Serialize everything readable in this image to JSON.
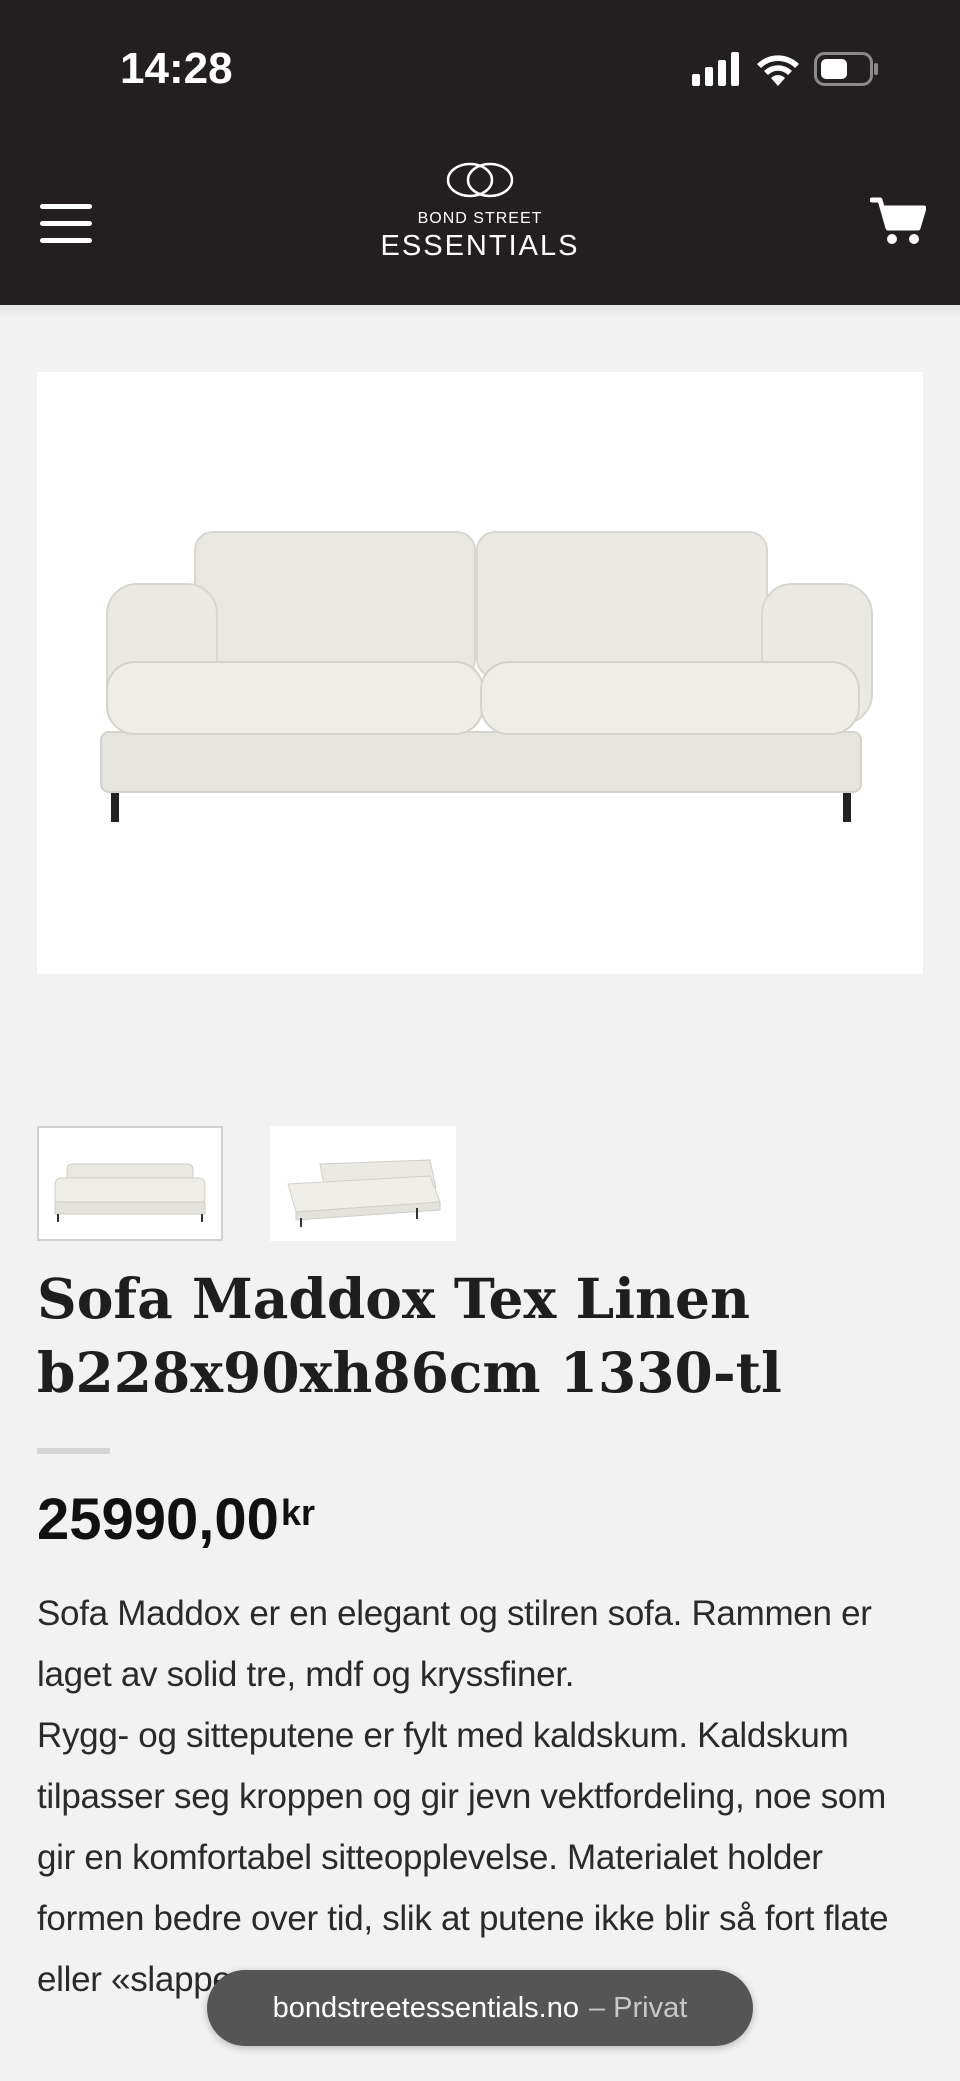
{
  "status_bar": {
    "time": "14:28",
    "icons": [
      "signal-icon",
      "wifi-icon",
      "battery-icon"
    ]
  },
  "header": {
    "logo_line1": "BOND STREET",
    "logo_line2": "ESSENTIALS",
    "menu_icon": "hamburger-menu-icon",
    "cart_icon": "cart-icon",
    "background": "#231f20"
  },
  "product": {
    "title": "Sofa Maddox Tex Linen b228x90xh86cm 1330-tl",
    "price": "25990,00",
    "currency": "kr",
    "description_lines": [
      "Sofa Maddox er en elegant og stilren sofa. Rammen er",
      "laget av solid tre, mdf og kryssfiner.",
      "Rygg- og sitteputene er fylt med kaldskum. Kaldskum",
      "tilpasser seg kroppen og gir jevn vektfordeling, noe som",
      "gir en komfortabel sitteopplevelse. Materialet holder",
      "formen bedre over tid, slik at putene ikke blir så fort flate",
      "eller «slappe"
    ]
  },
  "browser": {
    "domain": "bondstreetessentials.no",
    "mode": "– Privat"
  }
}
